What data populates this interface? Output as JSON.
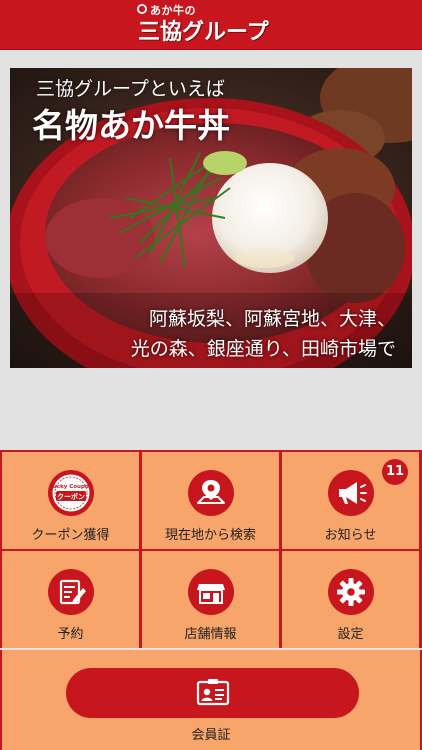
{
  "header": {
    "logo_small": "あか牛の",
    "logo_big": "三協グループ"
  },
  "hero": {
    "subtitle": "三協グループといえば",
    "title": "名物あか牛丼",
    "line1": "阿蘇坂梨、阿蘇宮地、大津、",
    "line2": "光の森、銀座通り、田崎市場で"
  },
  "menu": {
    "items": [
      {
        "label": "クーポン獲得",
        "icon": "coupon-icon"
      },
      {
        "label": "現在地から検索",
        "icon": "map-pin-icon"
      },
      {
        "label": "お知らせ",
        "icon": "megaphone-icon"
      },
      {
        "label": "予約",
        "icon": "reservation-icon"
      },
      {
        "label": "店舗情報",
        "icon": "store-icon"
      },
      {
        "label": "設定",
        "icon": "gear-icon"
      }
    ],
    "coupon_icon_text_top": "Lucky Coupon",
    "coupon_icon_text": "クーポン",
    "notification_count": "11"
  },
  "member": {
    "label": "会員証",
    "icon": "member-card-icon"
  },
  "colors": {
    "brand_red": "#c8161e",
    "tile_orange": "#f7a56a",
    "background": "#e2e2e2"
  }
}
